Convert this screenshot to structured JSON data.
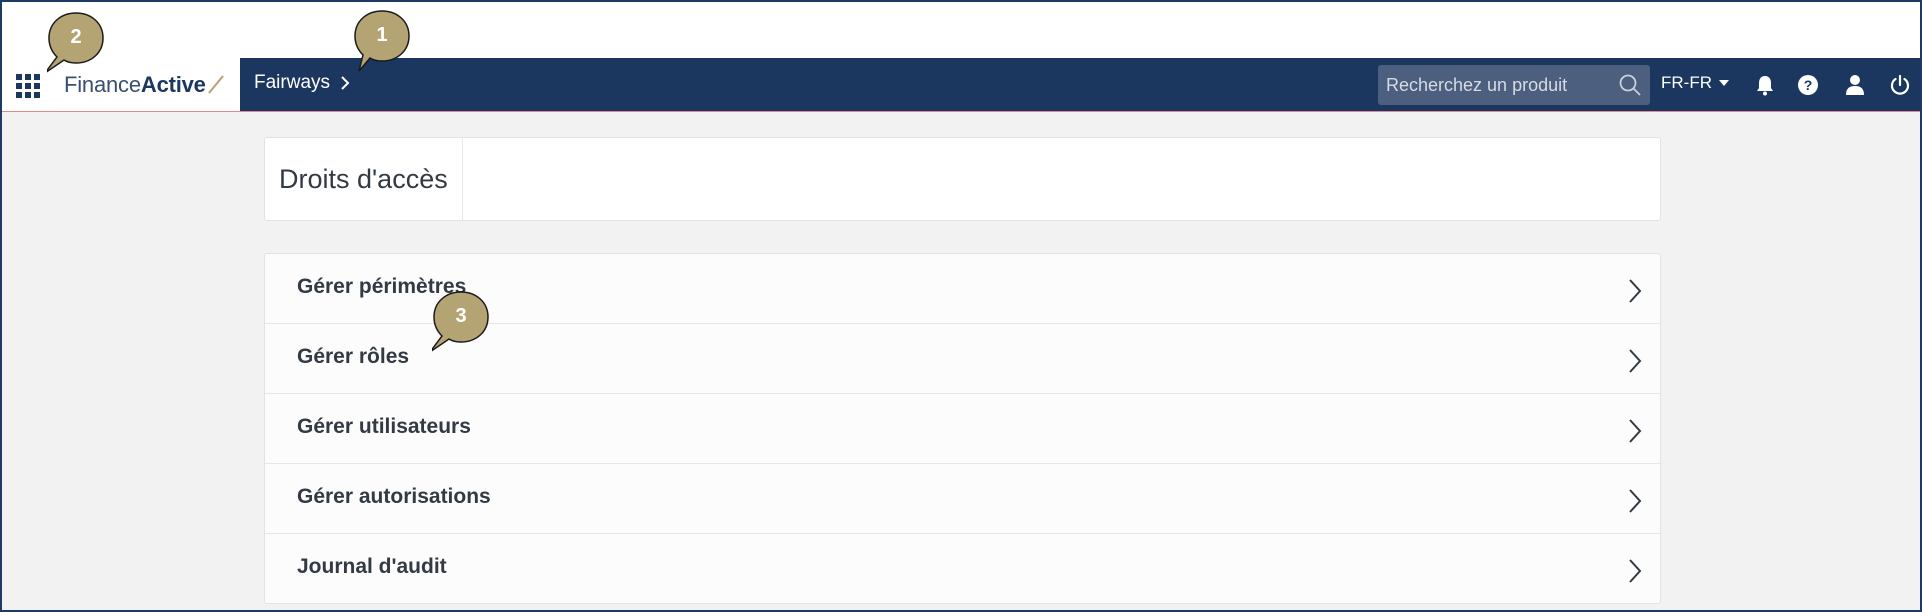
{
  "header": {
    "logo": {
      "light": "Finance",
      "bold": "Active"
    },
    "breadcrumb": {
      "label": "Fairways"
    },
    "search": {
      "placeholder": "Recherchez un produit"
    },
    "language": {
      "label": "FR-FR"
    },
    "icons": [
      "apps-grid-icon",
      "search-icon",
      "caret-down-icon",
      "bell-icon",
      "help-icon",
      "user-icon",
      "power-icon"
    ]
  },
  "page": {
    "title": "Droits d'accès"
  },
  "menu": {
    "items": [
      {
        "label": "Gérer périmètres"
      },
      {
        "label": "Gérer rôles"
      },
      {
        "label": "Gérer utilisateurs"
      },
      {
        "label": "Gérer autorisations"
      },
      {
        "label": "Journal d'audit"
      }
    ]
  },
  "callouts": [
    "1",
    "2",
    "3"
  ],
  "colors": {
    "header_bg": "#1b365f",
    "logo_accent": "#b5a473",
    "callout_fill": "#b5a473",
    "page_bg": "#f2f2f2"
  }
}
